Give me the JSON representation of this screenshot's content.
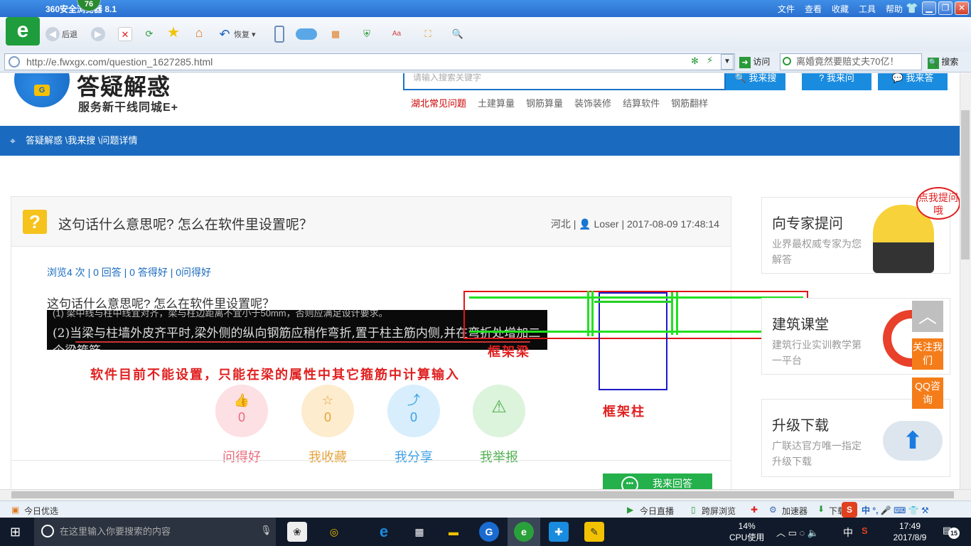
{
  "browser": {
    "title": "360安全浏览器 8.1",
    "badge_count": "76",
    "menu": [
      "文件",
      "查看",
      "收藏",
      "工具",
      "帮助"
    ],
    "toolbar": {
      "back": "后退",
      "restore": "恢复"
    },
    "url": "http://e.fwxgx.com/question_1627285.html",
    "visit_label": "访问",
    "hot_search": "离婚竟然要赔丈夫70亿！",
    "search_label": "搜索"
  },
  "site": {
    "name": "答疑解惑",
    "slogan": "服务新干线同城E+",
    "search_placeholder": "请输入搜索关键字",
    "btn_search": "我来搜",
    "btn_ask": "我来问",
    "btn_answer": "我来答",
    "hot_links": [
      "湖北常见问题",
      "土建算量",
      "钢筋算量",
      "装饰装修",
      "结算软件",
      "钢筋翻样"
    ],
    "breadcrumb": "答疑解惑 \\我来搜 \\问题详情"
  },
  "question": {
    "title": "这句话什么意思呢? 怎么在软件里设置呢？",
    "meta": "河北 | 👤 Loser | 2017-08-09 17:48:14",
    "stats": "浏览4 次 | 0 回答 | 0 答得好 | 0问得好",
    "body": "这句话什么意思呢? 怎么在软件里设置呢？",
    "image_line1": "(1) 梁中线与柱中线宜对齐，梁与柱边距离不宜小于50mm，否则应满足设计要求。",
    "image_line2": "(2)当梁与柱墙外皮齐平时,梁外侧的纵向钢筋应稍作弯折,置于柱主筋内侧,并在弯折处增加二个梁箍筋。",
    "red_note": "软件目前不能设置，只能在梁的属性中其它箍筋中计算输入",
    "label_beam": "框架梁",
    "label_column": "框架柱",
    "actions": [
      {
        "label": "问得好",
        "count": "0",
        "icon": "thumb-up-icon",
        "color": "#e96a7c",
        "bg": "#fde0e4"
      },
      {
        "label": "我收藏",
        "count": "0",
        "icon": "star-icon",
        "color": "#e5a33a",
        "bg": "#fdeccd"
      },
      {
        "label": "我分享",
        "count": "0",
        "icon": "share-icon",
        "color": "#3b9fe6",
        "bg": "#d8eefc"
      },
      {
        "label": "我举报",
        "count": "",
        "icon": "warning-icon",
        "color": "#4fb04f",
        "bg": "#dcf3dc"
      }
    ],
    "answer_button": "我来回答"
  },
  "sidebar": {
    "cards": [
      {
        "title": "向专家提问",
        "sub": "业界最权威专家为您解答",
        "bubble": "点我提问哦"
      },
      {
        "title": "建筑课堂",
        "sub": "建筑行业实训教学第一平台"
      },
      {
        "title": "升级下载",
        "sub": "广联达官方唯一指定升级下载"
      }
    ],
    "float_follow": "关注我们",
    "float_qq": "QQ咨询"
  },
  "statusbar": {
    "left": "今日优选",
    "live": "今日直播",
    "cross": "跨屏浏览",
    "accel": "加速器",
    "download": "下载"
  },
  "taskbar": {
    "search_placeholder": "在这里输入你要搜索的内容",
    "cpu_pct": "14%",
    "cpu_label": "CPU使用",
    "ime": "中",
    "time": "17:49",
    "date": "2017/8/9",
    "notify_count": "15"
  }
}
